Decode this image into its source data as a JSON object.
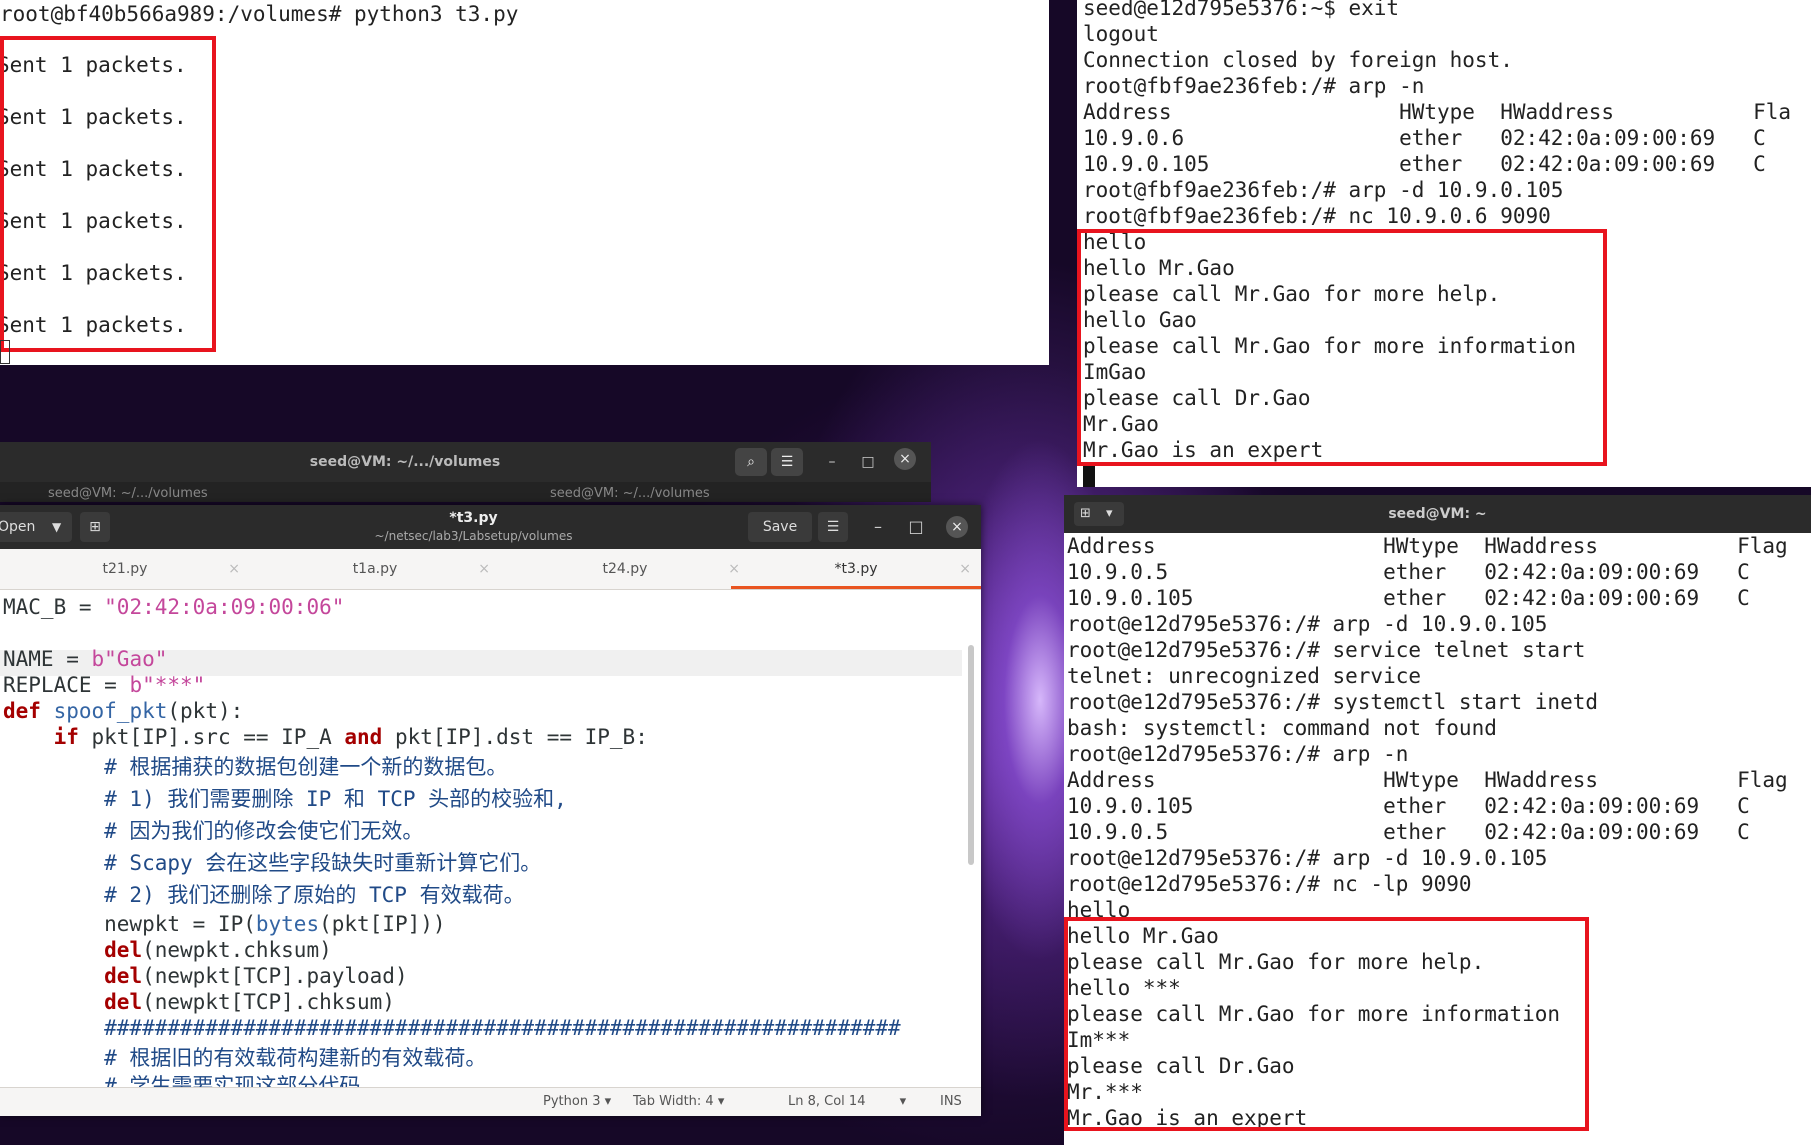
{
  "terminal_top_left": {
    "prompt": "root@bf40b566a989:/volumes# python3 t3.py",
    "outputs": [
      ".",
      "Sent 1 packets.",
      ".",
      "Sent 1 packets.",
      ".",
      "Sent 1 packets.",
      ".",
      "Sent 1 packets.",
      ".",
      "Sent 1 packets.",
      ".",
      "Sent 1 packets."
    ]
  },
  "terminal_top_right": {
    "lines": [
      "seed@e12d795e5376:~$ exit",
      "logout",
      "Connection closed by foreign host.",
      "root@fbf9ae236feb:/# arp -n",
      "Address                  HWtype  HWaddress           Fla",
      "10.9.0.6                 ether   02:42:0a:09:00:69   C",
      "10.9.0.105               ether   02:42:0a:09:00:69   C",
      "root@fbf9ae236feb:/# arp -d 10.9.0.105",
      "root@fbf9ae236feb:/# nc 10.9.0.6 9090",
      "hello",
      "hello Mr.Gao",
      "please call Mr.Gao for more help.",
      "hello Gao",
      "please call Mr.Gao for more information",
      "ImGao",
      "please call Dr.Gao",
      "Mr.Gao",
      "Mr.Gao is an expert"
    ]
  },
  "terminal_bottom_right": {
    "title": "seed@VM: ~",
    "lines": [
      "Address                  HWtype  HWaddress           Flag",
      "10.9.0.5                 ether   02:42:0a:09:00:69   C",
      "10.9.0.105               ether   02:42:0a:09:00:69   C",
      "root@e12d795e5376:/# arp -d 10.9.0.105",
      "root@e12d795e5376:/# service telnet start",
      "telnet: unrecognized service",
      "root@e12d795e5376:/# systemctl start inetd",
      "bash: systemctl: command not found",
      "root@e12d795e5376:/# arp -n",
      "Address                  HWtype  HWaddress           Flag",
      "10.9.0.105               ether   02:42:0a:09:00:69   C",
      "10.9.0.5                 ether   02:42:0a:09:00:69   C",
      "root@e12d795e5376:/# arp -d 10.9.0.105",
      "root@e12d795e5376:/# nc -lp 9090",
      "hello",
      "hello Mr.Gao",
      "please call Mr.Gao for more help.",
      "hello ***",
      "please call Mr.Gao for more information",
      "Im***",
      "please call Dr.Gao",
      "Mr.***",
      "Mr.Gao is an expert"
    ]
  },
  "terminal_back": {
    "title": "seed@VM: ~/.../volumes",
    "tab1": "seed@VM: ~/.../volumes",
    "tab2": "seed@VM: ~/.../volumes"
  },
  "gedit": {
    "open_label": "Open",
    "title": "*t3.py",
    "subtitle": "~/netsec/lab3/Labsetup/volumes",
    "save_label": "Save",
    "tabs": [
      "t21.py",
      "t1a.py",
      "t24.py",
      "*t3.py"
    ],
    "status": {
      "language": "Python 3",
      "tab_width": "Tab Width: 4",
      "position": "Ln 8, Col 14",
      "mode": "INS"
    }
  },
  "colors": {
    "highlight_red": "#e8141e",
    "keyword": "#a40000",
    "string": "#c4479b",
    "builtin": "#3465a4",
    "comment": "#204a87"
  }
}
